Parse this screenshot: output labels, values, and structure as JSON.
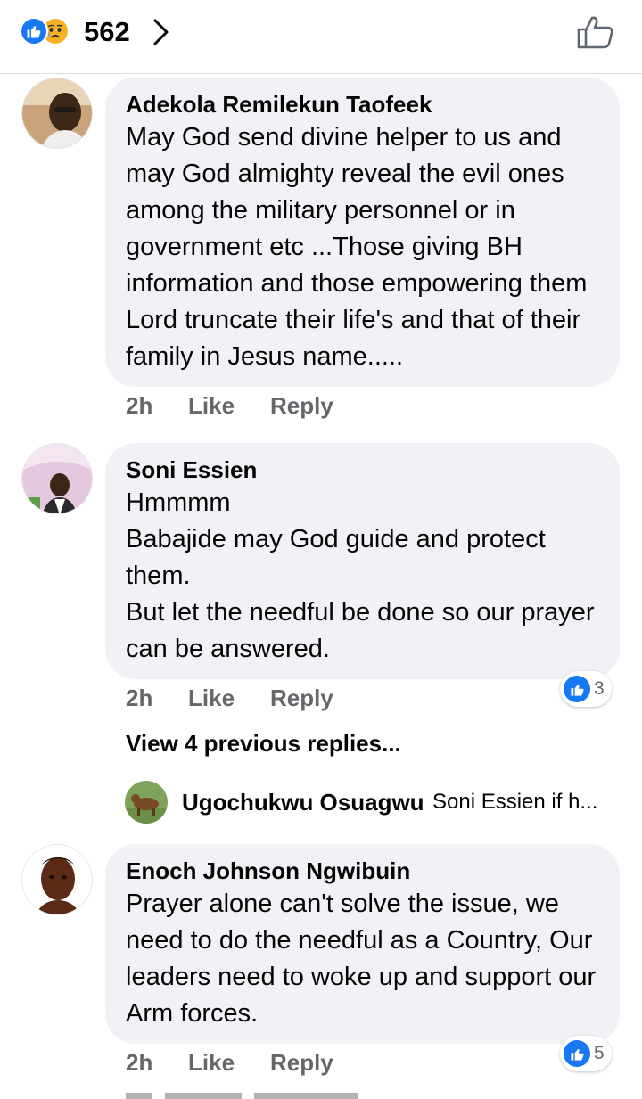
{
  "header": {
    "reaction_count": "562",
    "reaction_icons": [
      "like-reaction-icon",
      "sad-reaction-icon"
    ],
    "chevron_icon": "chevron-right-icon",
    "like_button_icon": "thumbs-up-outline-icon"
  },
  "colors": {
    "accent": "#1877f2",
    "bubble": "#f0f2f5",
    "muted": "#65676b",
    "text": "#050505"
  },
  "comments": [
    {
      "author": "Adekola Remilekun Taofeek",
      "text": "May God send divine helper to us and may God almighty reveal the evil ones among the military personnel or in government etc ...Those giving BH information and those empowering them Lord truncate their life's and that of their family in Jesus name.....",
      "time": "2h",
      "like_label": "Like",
      "reply_label": "Reply"
    },
    {
      "author": "Soni Essien",
      "text": "Hmmmm\nBabajide may God guide and protect them.\nBut let the needful be done so our prayer can be answered.",
      "time": "2h",
      "like_label": "Like",
      "reply_label": "Reply",
      "reaction_count": "3",
      "view_replies": "View 4 previous replies...",
      "latest_reply": {
        "author": "Ugochukwu Osuagwu",
        "snippet": "Soni Essien  if h..."
      }
    },
    {
      "author": "Enoch Johnson Ngwibuin",
      "text": "Prayer alone can't solve the issue, we need to do the needful as a Country, Our leaders need to woke up and support our Arm forces.",
      "time": "2h",
      "like_label": "Like",
      "reply_label": "Reply",
      "reaction_count": "5"
    }
  ]
}
